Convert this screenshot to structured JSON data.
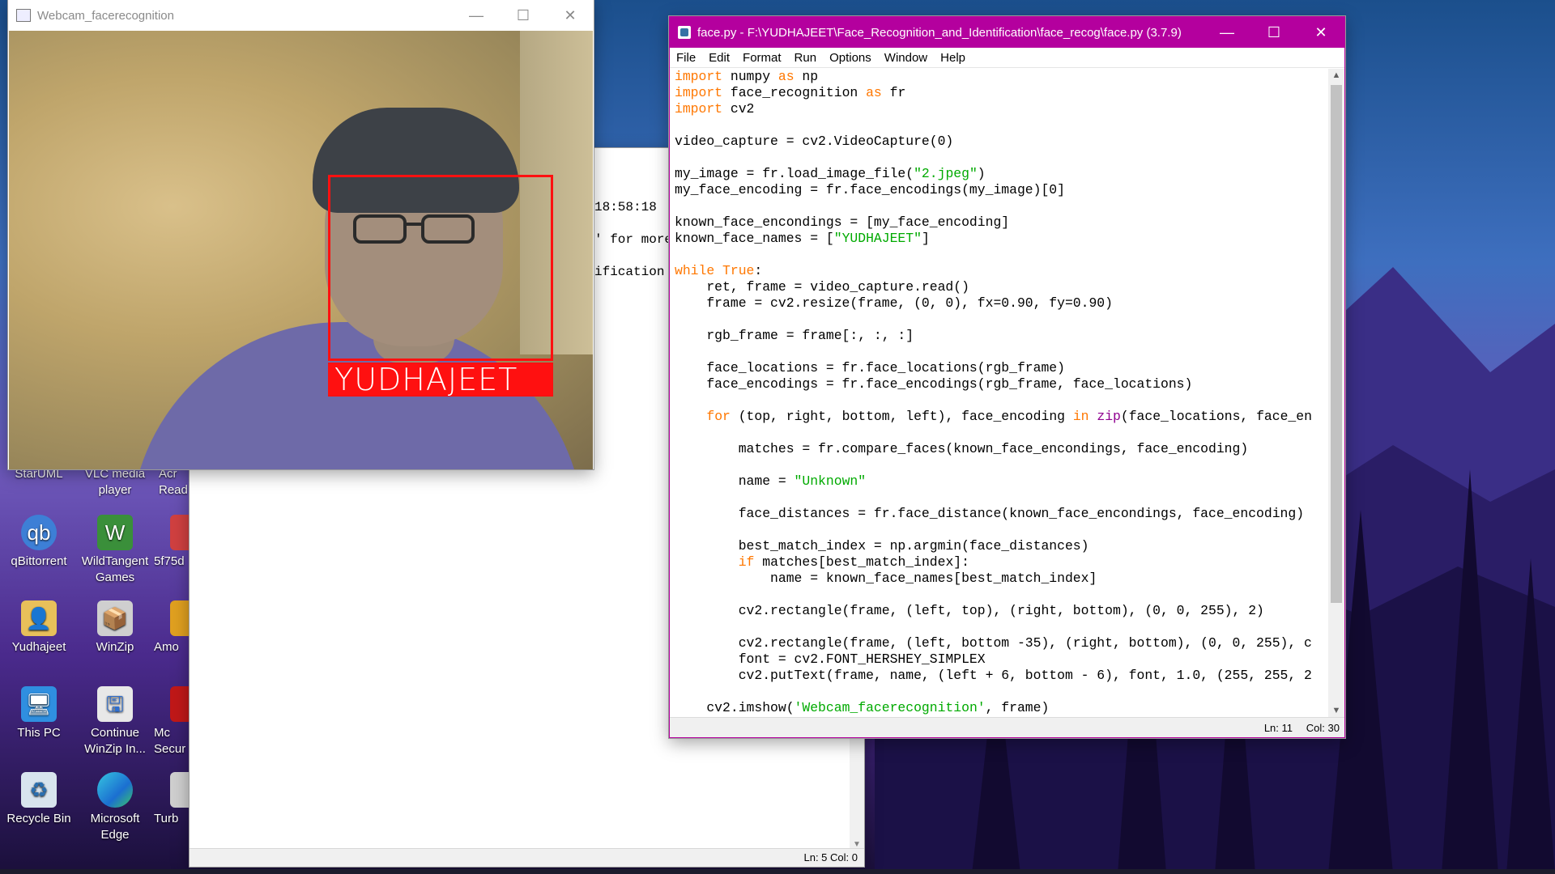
{
  "desktop": {
    "top_labels": [
      {
        "label": "StarUML"
      },
      {
        "label": "VLC media player"
      },
      {
        "label": "Acr Read"
      }
    ],
    "icons": [
      {
        "label": "qBittorrent",
        "icon": "qbittorrent-icon"
      },
      {
        "label": "WildTangent Games",
        "icon": "wildtangent-icon"
      },
      {
        "label": "5f75d",
        "icon": "file-icon"
      },
      {
        "label": "Yudhajeet",
        "icon": "user-folder-icon"
      },
      {
        "label": "WinZip",
        "icon": "winzip-icon"
      },
      {
        "label": "Amo",
        "icon": "app-icon"
      },
      {
        "label": "This PC",
        "icon": "computer-icon"
      },
      {
        "label": "Continue WinZip In...",
        "icon": "winzip-installer-icon"
      },
      {
        "label": "Mc Secur",
        "icon": "mcafee-icon"
      },
      {
        "label": "Recycle Bin",
        "icon": "recycle-bin-icon"
      },
      {
        "label": "Microsoft Edge",
        "icon": "edge-icon"
      },
      {
        "label": "Turb",
        "icon": "app-icon"
      }
    ]
  },
  "bg_window": {
    "fragments": [
      "18:58:18",
      "' for more",
      "ification"
    ],
    "status": "Ln: 5   Col: 0"
  },
  "cam_window": {
    "title": "Webcam_facerecognition",
    "label": "YUDHAJEET"
  },
  "idle_window": {
    "title": "face.py - F:\\YUDHAJEET\\Face_Recognition_and_Identification\\face_recog\\face.py (3.7.9)",
    "menu": [
      "File",
      "Edit",
      "Format",
      "Run",
      "Options",
      "Window",
      "Help"
    ],
    "status_ln": "Ln: 11",
    "status_col": "Col: 30"
  },
  "code_lines": [
    [
      [
        "kw",
        "import"
      ],
      [
        "t",
        " numpy "
      ],
      [
        "kw",
        "as"
      ],
      [
        "t",
        " np"
      ]
    ],
    [
      [
        "kw",
        "import"
      ],
      [
        "t",
        " face_recognition "
      ],
      [
        "kw",
        "as"
      ],
      [
        "t",
        " fr"
      ]
    ],
    [
      [
        "kw",
        "import"
      ],
      [
        "t",
        " cv2"
      ]
    ],
    [
      [
        "t",
        ""
      ]
    ],
    [
      [
        "t",
        "video_capture = cv2.VideoCapture(0)"
      ]
    ],
    [
      [
        "t",
        ""
      ]
    ],
    [
      [
        "t",
        "my_image = fr.load_image_file("
      ],
      [
        "str",
        "\"2.jpeg\""
      ],
      [
        "t",
        ")"
      ]
    ],
    [
      [
        "t",
        "my_face_encoding = fr.face_encodings(my_image)[0]"
      ]
    ],
    [
      [
        "t",
        ""
      ]
    ],
    [
      [
        "t",
        "known_face_encondings = [my_face_encoding]"
      ]
    ],
    [
      [
        "t",
        "known_face_names = ["
      ],
      [
        "str",
        "\"YUDHAJEET\""
      ],
      [
        "t",
        "]"
      ]
    ],
    [
      [
        "t",
        ""
      ]
    ],
    [
      [
        "kw",
        "while"
      ],
      [
        "t",
        " "
      ],
      [
        "kw",
        "True"
      ],
      [
        "t",
        ":"
      ]
    ],
    [
      [
        "t",
        "    ret, frame = video_capture.read()"
      ]
    ],
    [
      [
        "t",
        "    frame = cv2.resize(frame, (0, 0), fx=0.90, fy=0.90)"
      ]
    ],
    [
      [
        "t",
        ""
      ]
    ],
    [
      [
        "t",
        "    rgb_frame = frame[:, :, :]"
      ]
    ],
    [
      [
        "t",
        ""
      ]
    ],
    [
      [
        "t",
        "    face_locations = fr.face_locations(rgb_frame)"
      ]
    ],
    [
      [
        "t",
        "    face_encodings = fr.face_encodings(rgb_frame, face_locations)"
      ]
    ],
    [
      [
        "t",
        ""
      ]
    ],
    [
      [
        "t",
        "    "
      ],
      [
        "kw",
        "for"
      ],
      [
        "t",
        " (top, right, bottom, left), face_encoding "
      ],
      [
        "kw",
        "in"
      ],
      [
        "t",
        " "
      ],
      [
        "bi",
        "zip"
      ],
      [
        "t",
        "(face_locations, face_en"
      ]
    ],
    [
      [
        "t",
        ""
      ]
    ],
    [
      [
        "t",
        "        matches = fr.compare_faces(known_face_encondings, face_encoding)"
      ]
    ],
    [
      [
        "t",
        ""
      ]
    ],
    [
      [
        "t",
        "        name = "
      ],
      [
        "str",
        "\"Unknown\""
      ]
    ],
    [
      [
        "t",
        ""
      ]
    ],
    [
      [
        "t",
        "        face_distances = fr.face_distance(known_face_encondings, face_encoding)"
      ]
    ],
    [
      [
        "t",
        ""
      ]
    ],
    [
      [
        "t",
        "        best_match_index = np.argmin(face_distances)"
      ]
    ],
    [
      [
        "t",
        "        "
      ],
      [
        "kw",
        "if"
      ],
      [
        "t",
        " matches[best_match_index]:"
      ]
    ],
    [
      [
        "t",
        "            name = known_face_names[best_match_index]"
      ]
    ],
    [
      [
        "t",
        ""
      ]
    ],
    [
      [
        "t",
        "        cv2.rectangle(frame, (left, top), (right, bottom), (0, 0, 255), 2)"
      ]
    ],
    [
      [
        "t",
        ""
      ]
    ],
    [
      [
        "t",
        "        cv2.rectangle(frame, (left, bottom -35), (right, bottom), (0, 0, 255), c"
      ]
    ],
    [
      [
        "t",
        "        font = cv2.FONT_HERSHEY_SIMPLEX"
      ]
    ],
    [
      [
        "t",
        "        cv2.putText(frame, name, (left + 6, bottom - 6), font, 1.0, (255, 255, 2"
      ]
    ],
    [
      [
        "t",
        ""
      ]
    ],
    [
      [
        "t",
        "    cv2.imshow("
      ],
      [
        "str",
        "'Webcam_facerecognition'"
      ],
      [
        "t",
        ", frame)"
      ]
    ]
  ]
}
